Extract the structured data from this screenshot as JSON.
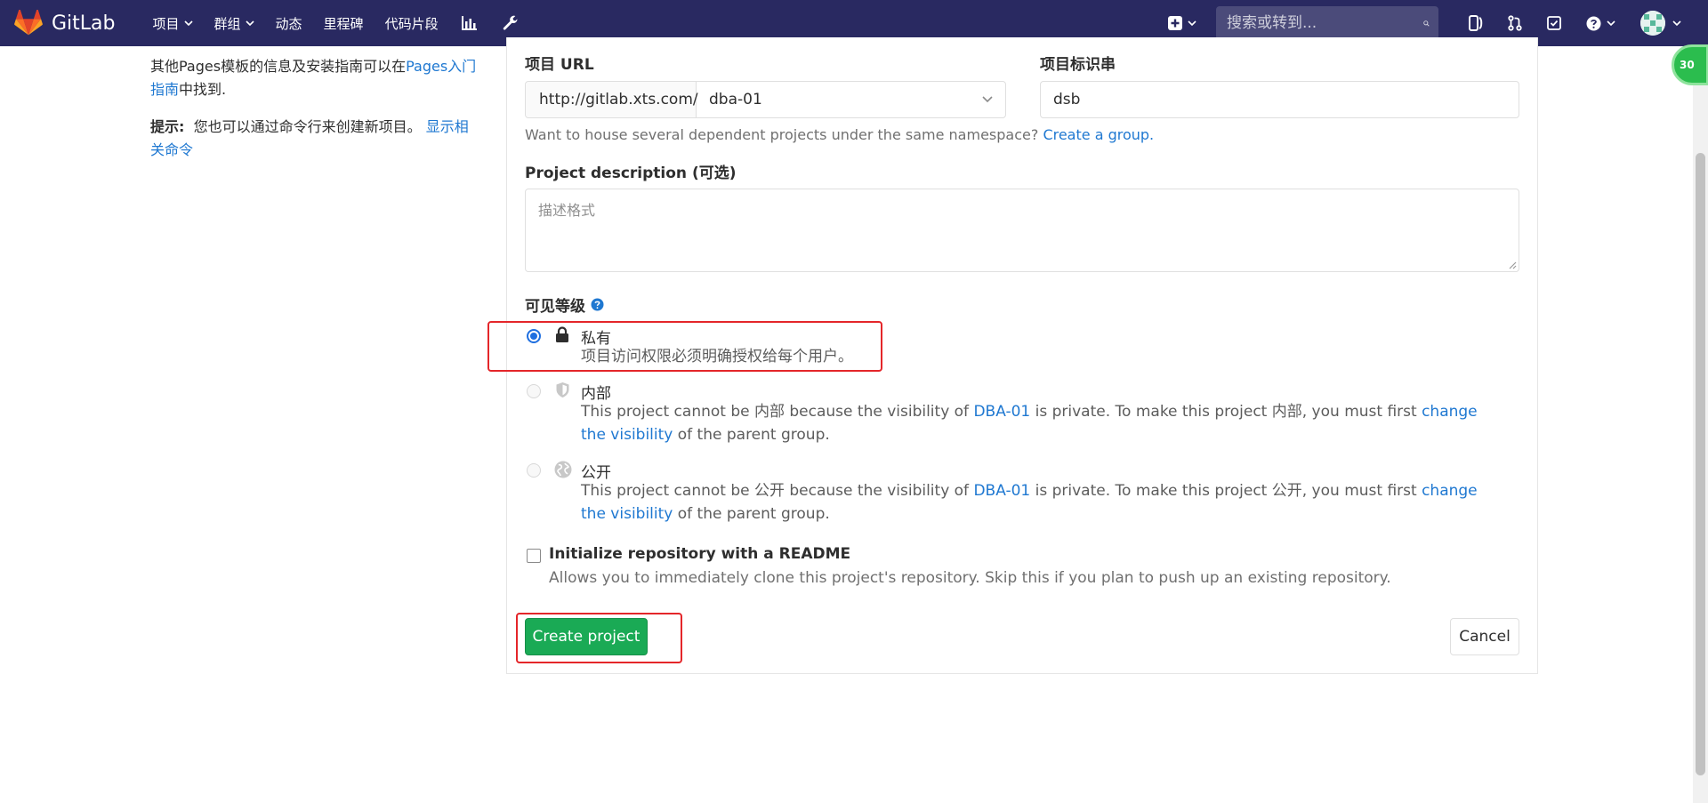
{
  "navbar": {
    "brand": "GitLab",
    "items": [
      {
        "label": "项目",
        "caret": true
      },
      {
        "label": "群组",
        "caret": true
      },
      {
        "label": "动态",
        "caret": false
      },
      {
        "label": "里程碑",
        "caret": false
      },
      {
        "label": "代码片段",
        "caret": false
      }
    ],
    "search_placeholder": "搜索或转到...",
    "icons": [
      "chart-icon",
      "wrench-icon",
      "plus-square-icon",
      "issues-icon",
      "merge-request-icon",
      "todo-icon",
      "help-icon"
    ]
  },
  "sidebar": {
    "pages_text_prefix": "其他Pages模板的信息及安装指南可以在",
    "pages_link": "Pages入门指南",
    "pages_text_suffix": "中找到.",
    "tip_label": "提示:",
    "tip_text": "您也可以通过命令行来创建新项目。",
    "tip_link": "显示相关命令"
  },
  "form": {
    "project_url_label": "项目 URL",
    "url_prefix": "http://gitlab.xts.com/",
    "namespace_value": "dba-01",
    "slug_label": "项目标识串",
    "slug_value": "dsb",
    "namespace_help": "Want to house several dependent projects under the same namespace?",
    "namespace_help_link": "Create a group.",
    "description_label": "Project description",
    "description_optional": "(可选)",
    "description_placeholder": "描述格式",
    "visibility_label": "可见等级",
    "visibility_options": [
      {
        "title": "私有",
        "desc": "项目访问权限必须明确授权给每个用户。",
        "checked": true
      },
      {
        "title": "内部",
        "desc_1": "This project cannot be 内部 because the visibility of ",
        "desc_link_1": "DBA-01",
        "desc_2": " is private. To make this project 内部, you must first ",
        "desc_link_2": "change the visibility",
        "desc_3": " of the parent group."
      },
      {
        "title": "公开",
        "desc_1": "This project cannot be 公开 because the visibility of ",
        "desc_link_1": "DBA-01",
        "desc_2": " is private. To make this project 公开, you must first ",
        "desc_link_2": "change the visibility",
        "desc_3": " of the parent group."
      }
    ],
    "readme_label": "Initialize repository with a README",
    "readme_desc": "Allows you to immediately clone this project's repository. Skip this if you plan to push up an existing repository.",
    "create_label": "Create project",
    "cancel_label": "Cancel"
  },
  "overlay": {
    "badge_text": "30"
  },
  "colors": {
    "navbar": "#292961",
    "link": "#1f78d1",
    "primary": "#1aaa55",
    "highlight": "#e4262a"
  }
}
